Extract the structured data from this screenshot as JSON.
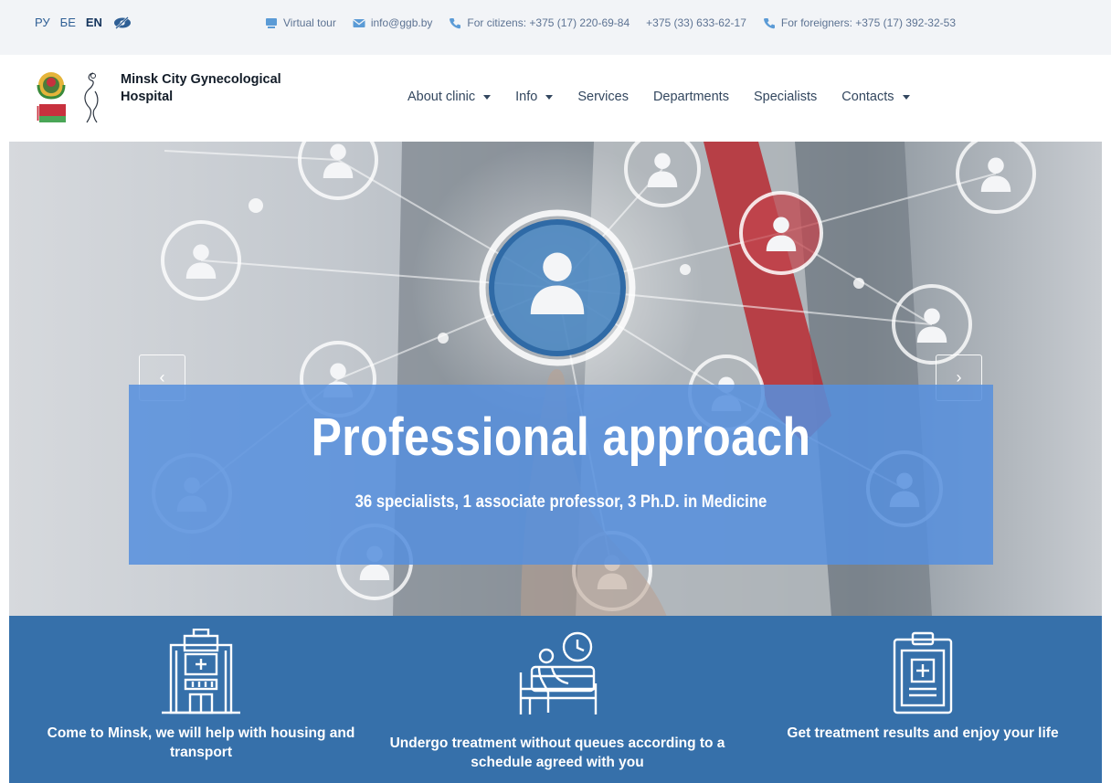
{
  "topbar": {
    "languages": [
      {
        "code": "РУ",
        "active": false
      },
      {
        "code": "БЕ",
        "active": false
      },
      {
        "code": "EN",
        "active": true
      }
    ],
    "accessibility_icon": "eye-slash-icon",
    "virtual_tour": "Virtual tour",
    "email": "info@ggb.by",
    "phone_citizens": "For citizens: +375 (17) 220-69-84",
    "phone_citizens_mobile": "+375 (33) 633-62-17",
    "phone_foreigners": "For foreigners: +375 (17) 392-32-53"
  },
  "header": {
    "brand_name": "Minsk City Gynecological Hospital",
    "nav": [
      {
        "label": "About clinic",
        "dropdown": true
      },
      {
        "label": "Info",
        "dropdown": true
      },
      {
        "label": "Services",
        "dropdown": false
      },
      {
        "label": "Departments",
        "dropdown": false
      },
      {
        "label": "Specialists",
        "dropdown": false
      },
      {
        "label": "Contacts",
        "dropdown": true
      }
    ]
  },
  "hero": {
    "headline": "Professional approach",
    "subline": "36 specialists, 1 associate professor, 3 Ph.D. in Medicine",
    "prev_icon": "chevron-left-icon",
    "next_icon": "chevron-right-icon"
  },
  "features": [
    {
      "icon": "hospital-building-icon",
      "text": "Come to Minsk, we will help with housing and transport"
    },
    {
      "icon": "patient-bed-clock-icon",
      "text": "Undergo treatment without queues according to a schedule agreed with you"
    },
    {
      "icon": "medical-clipboard-icon",
      "text": "Get treatment results and enjoy your life"
    }
  ],
  "colors": {
    "topbar_bg": "#f2f4f7",
    "banner": "#568fdd",
    "features_bg": "#3670aa",
    "link": "#2f5f95",
    "flag_red": "#c8313e",
    "flag_green": "#4aa657"
  }
}
